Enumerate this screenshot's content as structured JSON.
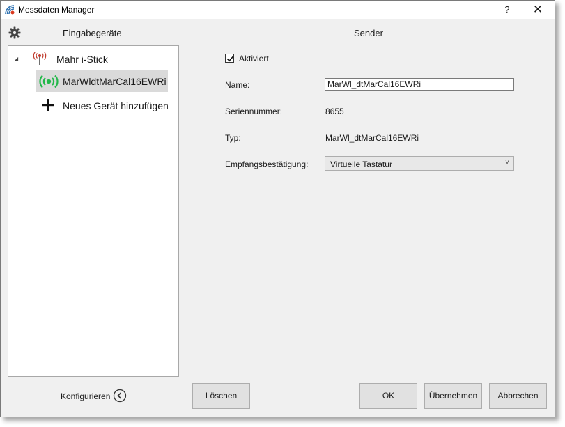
{
  "window": {
    "title": "Messdaten Manager",
    "help_label": "?",
    "close_label": "✕"
  },
  "left_panel": {
    "title": "Eingabegeräte",
    "tree": {
      "root_label": "Mahr i-Stick",
      "child_label": "MarWldtMarCal16EWRi",
      "add_label": "Neues Gerät hinzufügen"
    },
    "configure_label": "Konfigurieren"
  },
  "right_panel": {
    "title": "Sender",
    "enabled_label": "Aktiviert",
    "enabled_checked": true,
    "name_label": "Name:",
    "name_value": "MarWl_dtMarCal16EWRi",
    "serial_label": "Seriennummer:",
    "serial_value": "8655",
    "type_label": "Typ:",
    "type_value": "MarWl_dtMarCal16EWRi",
    "ack_label": "Empfangsbestätigung:",
    "ack_value": "Virtuelle Tastatur"
  },
  "buttons": {
    "delete": "Löschen",
    "ok": "OK",
    "apply": "Übernehmen",
    "cancel": "Abbrechen"
  },
  "icons": {
    "app": "wireless-signal-icon",
    "settings": "gear-icon",
    "root_device": "antenna-icon",
    "child_device": "wireless-signal-icon",
    "add": "plus-icon",
    "configure": "chevron-left-circle-icon"
  },
  "colors": {
    "signal_green": "#22b84a",
    "antenna_red": "#c0392b",
    "selection": "#dadada"
  }
}
